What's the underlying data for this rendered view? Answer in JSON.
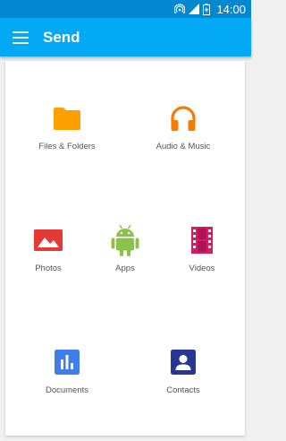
{
  "status_bar": {
    "time": "14:00",
    "icons": [
      "wifi-hotspot-icon",
      "signal-icon",
      "battery-icon"
    ]
  },
  "app_bar": {
    "title": "Send",
    "menu_icon": "hamburger-menu-icon",
    "color": "#03a9f4"
  },
  "grid": {
    "items": [
      {
        "label": "Files & Folders",
        "icon": "folder-icon",
        "color": "#ffa000"
      },
      {
        "label": "Audio & Music",
        "icon": "headphones-icon",
        "color": "#f57c00"
      },
      {
        "label": "Photos",
        "icon": "photo-icon",
        "color": "#e53935"
      },
      {
        "label": "Apps",
        "icon": "android-icon",
        "color": "#8bc34a"
      },
      {
        "label": "Videos",
        "icon": "film-icon",
        "color": "#d81b60"
      },
      {
        "label": "Documents",
        "icon": "bar-chart-document-icon",
        "color": "#3f7de8"
      },
      {
        "label": "Contacts",
        "icon": "contact-icon",
        "color": "#283593"
      }
    ]
  }
}
